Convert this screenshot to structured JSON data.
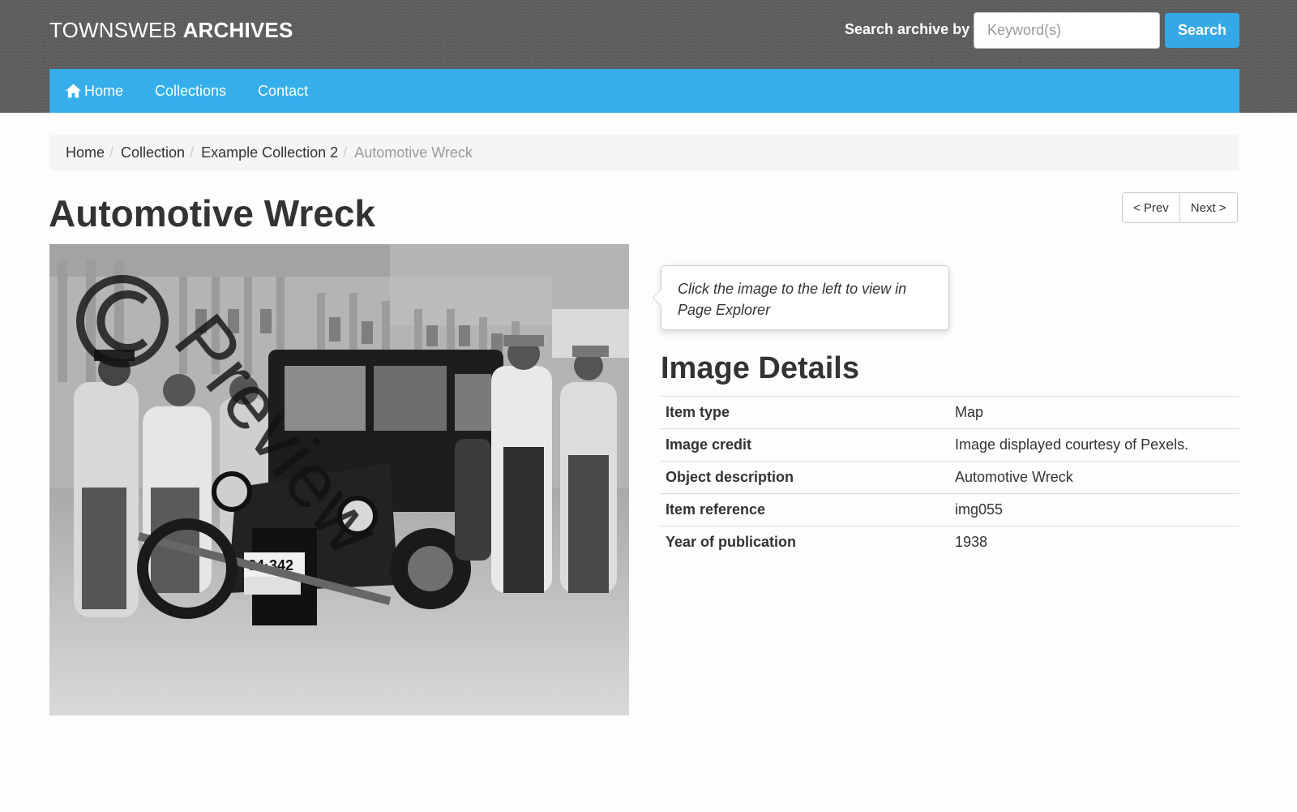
{
  "header": {
    "brand_light": "TOWNSWEB",
    "brand_bold": "ARCHIVES",
    "search_label": "Search archive by",
    "search_placeholder": "Keyword(s)",
    "search_button": "Search"
  },
  "nav": {
    "items": [
      {
        "label": "Home",
        "icon": "home-icon"
      },
      {
        "label": "Collections"
      },
      {
        "label": "Contact"
      }
    ]
  },
  "breadcrumb": {
    "items": [
      "Home",
      "Collection",
      "Example Collection 2",
      "Automotive Wreck"
    ],
    "separator": "/"
  },
  "page": {
    "title": "Automotive Wreck",
    "prev_label": "< Prev",
    "next_label": "Next >"
  },
  "image": {
    "watermark": "© Preview"
  },
  "hint": {
    "text": "Click the image to the left to view in Page Explorer"
  },
  "details": {
    "title": "Image Details",
    "rows": [
      {
        "key": "Item type",
        "value": "Map"
      },
      {
        "key": "Image credit",
        "value": "Image displayed courtesy of Pexels."
      },
      {
        "key": "Object description",
        "value": "Automotive Wreck"
      },
      {
        "key": "Item reference",
        "value": "img055"
      },
      {
        "key": "Year of publication",
        "value": "1938"
      }
    ]
  },
  "colors": {
    "accent": "#35aeeb",
    "header_bg": "#5d5d5d",
    "breadcrumb_bg": "#f5f5f5"
  }
}
